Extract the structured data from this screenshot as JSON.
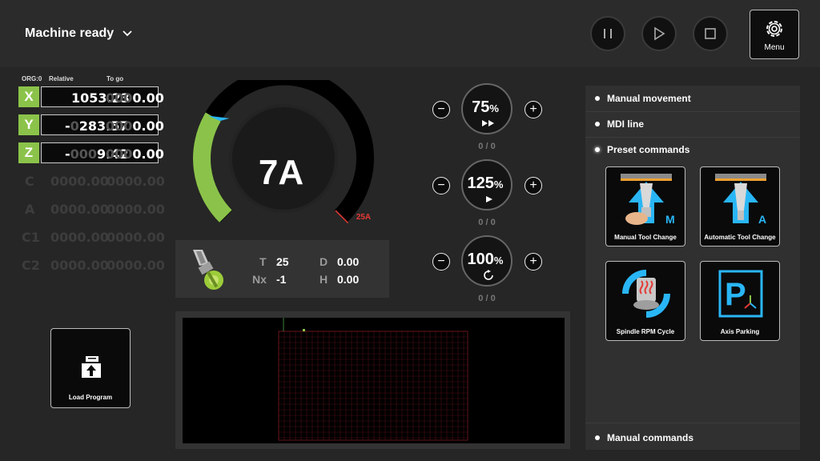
{
  "header": {
    "status": "Machine ready",
    "menu_label": "Menu",
    "buttons": [
      {
        "icon": "pause-icon"
      },
      {
        "icon": "play-icon"
      },
      {
        "icon": "stop-icon"
      }
    ]
  },
  "dro": {
    "org": "ORG:0",
    "relative_header": "Relative",
    "togo_header": "To go",
    "axes": [
      {
        "axis": "X",
        "rel_sign": "",
        "rel_dim": "",
        "rel_value": "1053.23",
        "togo_dim": "000",
        "togo_value": "0.00"
      },
      {
        "axis": "Y",
        "rel_sign": "-",
        "rel_dim": "0",
        "rel_value": "283.57",
        "togo_dim": "000",
        "togo_value": "0.00"
      },
      {
        "axis": "Z",
        "rel_sign": "-",
        "rel_dim": "000",
        "rel_value": "9.42",
        "togo_dim": "000",
        "togo_value": "0.00"
      }
    ],
    "inactive_axes": [
      {
        "axis": "C",
        "rel": "0000.00",
        "togo": "0000.00"
      },
      {
        "axis": "A",
        "rel": "0000.00",
        "togo": "0000.00"
      },
      {
        "axis": "C1",
        "rel": "0000.00",
        "togo": "0000.00"
      },
      {
        "axis": "C2",
        "rel": "0000.00",
        "togo": "0000.00"
      }
    ]
  },
  "gauge": {
    "value_label": "7A",
    "max_label": "25A",
    "value": 7,
    "max": 25,
    "active_color": "#8bc34a",
    "marker_color": "#29b6f6",
    "limit_color": "#e53935"
  },
  "tool": {
    "t_label": "T",
    "t_value": "25",
    "nx_label": "Nx",
    "nx_value": "-1",
    "d_label": "D",
    "d_value": "0.00",
    "h_label": "H",
    "h_value": "0.00"
  },
  "overrides": [
    {
      "value": "75",
      "unit": "%",
      "sub": "0 / 0",
      "icon": "fast-forward-icon"
    },
    {
      "value": "125",
      "unit": "%",
      "sub": "0 / 0",
      "icon": "play-icon"
    },
    {
      "value": "100",
      "unit": "%",
      "sub": "0 / 0",
      "icon": "spindle-rotate-icon"
    }
  ],
  "panel": {
    "items": [
      "Manual movement",
      "MDI line",
      "Preset commands"
    ],
    "footer": "Manual commands",
    "commands": [
      {
        "label": "Manual Tool Change",
        "badge": "M",
        "icon": "manual-tool-change-icon"
      },
      {
        "label": "Automatic Tool Change",
        "badge": "A",
        "icon": "automatic-tool-change-icon"
      },
      {
        "label": "Spindle RPM Cycle",
        "icon": "spindle-rpm-cycle-icon"
      },
      {
        "label": "Axis Parking",
        "badge": "P",
        "icon": "axis-parking-icon"
      }
    ]
  },
  "load_program": {
    "label": "Load Program"
  },
  "accent": "#29b6f6"
}
